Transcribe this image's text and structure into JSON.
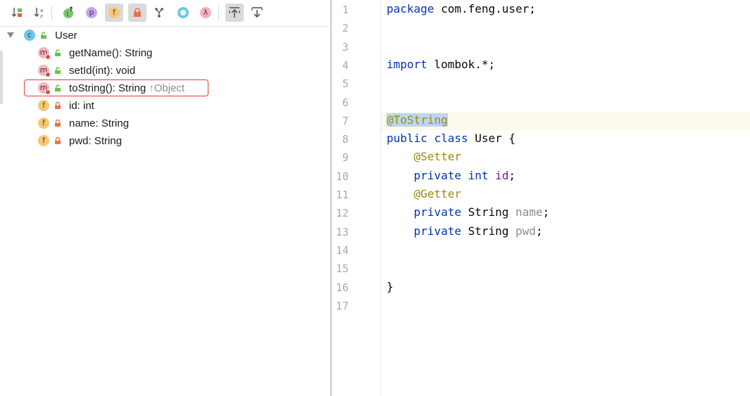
{
  "structure": {
    "toolbar": [
      {
        "icon": "sort-by-visibility-icon",
        "active": false
      },
      {
        "icon": "sort-alphabetically-icon",
        "active": false
      },
      {
        "icon": "show-inherited-icon",
        "active": false
      },
      {
        "icon": "show-properties-icon",
        "glyph": "p",
        "active": false
      },
      {
        "icon": "show-fields-icon",
        "glyph": "f",
        "active": true
      },
      {
        "icon": "show-non-public-icon",
        "active": true
      },
      {
        "icon": "show-lombok-icon",
        "active": false
      },
      {
        "icon": "show-anonymous-classes-icon",
        "active": false
      },
      {
        "icon": "show-lambdas-icon",
        "glyph": "λ",
        "active": false
      },
      {
        "icon": "autoscroll-to-source-icon",
        "active": true
      },
      {
        "icon": "autoscroll-from-source-icon",
        "active": false
      }
    ],
    "root": {
      "label": "User",
      "kind": "class",
      "badge": "c"
    },
    "members": [
      {
        "label": "getName(): String",
        "kind": "method",
        "badge": "m",
        "visibility": "public"
      },
      {
        "label": "setId(int): void",
        "kind": "method",
        "badge": "m",
        "visibility": "public"
      },
      {
        "label": "toString(): String",
        "super": "↑Object",
        "kind": "method",
        "badge": "m",
        "visibility": "public",
        "highlighted": true
      },
      {
        "label": "id: int",
        "kind": "field",
        "badge": "f",
        "visibility": "private"
      },
      {
        "label": "name: String",
        "kind": "field",
        "badge": "f",
        "visibility": "private"
      },
      {
        "label": "pwd: String",
        "kind": "field",
        "badge": "f",
        "visibility": "private"
      }
    ]
  },
  "editor": {
    "current_line": 7,
    "lines": [
      {
        "no": "1",
        "tokens": [
          {
            "t": "package",
            "c": "kw"
          },
          {
            "t": " com.feng.user;",
            "c": ""
          }
        ]
      },
      {
        "no": "2",
        "tokens": []
      },
      {
        "no": "3",
        "tokens": []
      },
      {
        "no": "4",
        "tokens": [
          {
            "t": "import",
            "c": "kw"
          },
          {
            "t": " lombok.*;",
            "c": ""
          }
        ]
      },
      {
        "no": "5",
        "tokens": []
      },
      {
        "no": "6",
        "tokens": []
      },
      {
        "no": "7",
        "tokens": [
          {
            "t": "@ToString",
            "c": "ann sel"
          }
        ]
      },
      {
        "no": "8",
        "tokens": [
          {
            "t": "public",
            "c": "kw"
          },
          {
            "t": " ",
            "c": ""
          },
          {
            "t": "class",
            "c": "kw"
          },
          {
            "t": " User {",
            "c": ""
          }
        ]
      },
      {
        "no": "9",
        "tokens": [
          {
            "t": "    ",
            "c": ""
          },
          {
            "t": "@Setter",
            "c": "ann"
          }
        ]
      },
      {
        "no": "10",
        "tokens": [
          {
            "t": "    ",
            "c": ""
          },
          {
            "t": "private",
            "c": "kw"
          },
          {
            "t": " ",
            "c": ""
          },
          {
            "t": "int",
            "c": "kw"
          },
          {
            "t": " ",
            "c": ""
          },
          {
            "t": "id",
            "c": "fld"
          },
          {
            "t": ";",
            "c": ""
          }
        ]
      },
      {
        "no": "11",
        "tokens": [
          {
            "t": "    ",
            "c": ""
          },
          {
            "t": "@Getter",
            "c": "ann"
          }
        ]
      },
      {
        "no": "12",
        "tokens": [
          {
            "t": "    ",
            "c": ""
          },
          {
            "t": "private",
            "c": "kw"
          },
          {
            "t": " String ",
            "c": ""
          },
          {
            "t": "name",
            "c": "prm"
          },
          {
            "t": ";",
            "c": ""
          }
        ]
      },
      {
        "no": "13",
        "tokens": [
          {
            "t": "    ",
            "c": ""
          },
          {
            "t": "private",
            "c": "kw"
          },
          {
            "t": " String ",
            "c": ""
          },
          {
            "t": "pwd",
            "c": "prm"
          },
          {
            "t": ";",
            "c": ""
          }
        ]
      },
      {
        "no": "14",
        "tokens": []
      },
      {
        "no": "15",
        "tokens": []
      },
      {
        "no": "16",
        "tokens": [
          {
            "t": "}",
            "c": ""
          }
        ]
      },
      {
        "no": "17",
        "tokens": []
      }
    ]
  },
  "colors": {
    "keyword": "#0033b3",
    "annotation": "#9e880d",
    "field": "#871094",
    "unused": "#8c8c8c",
    "selection": "#bbd7f0",
    "current_line": "#fcfaed",
    "highlight_border": "#e53935"
  }
}
